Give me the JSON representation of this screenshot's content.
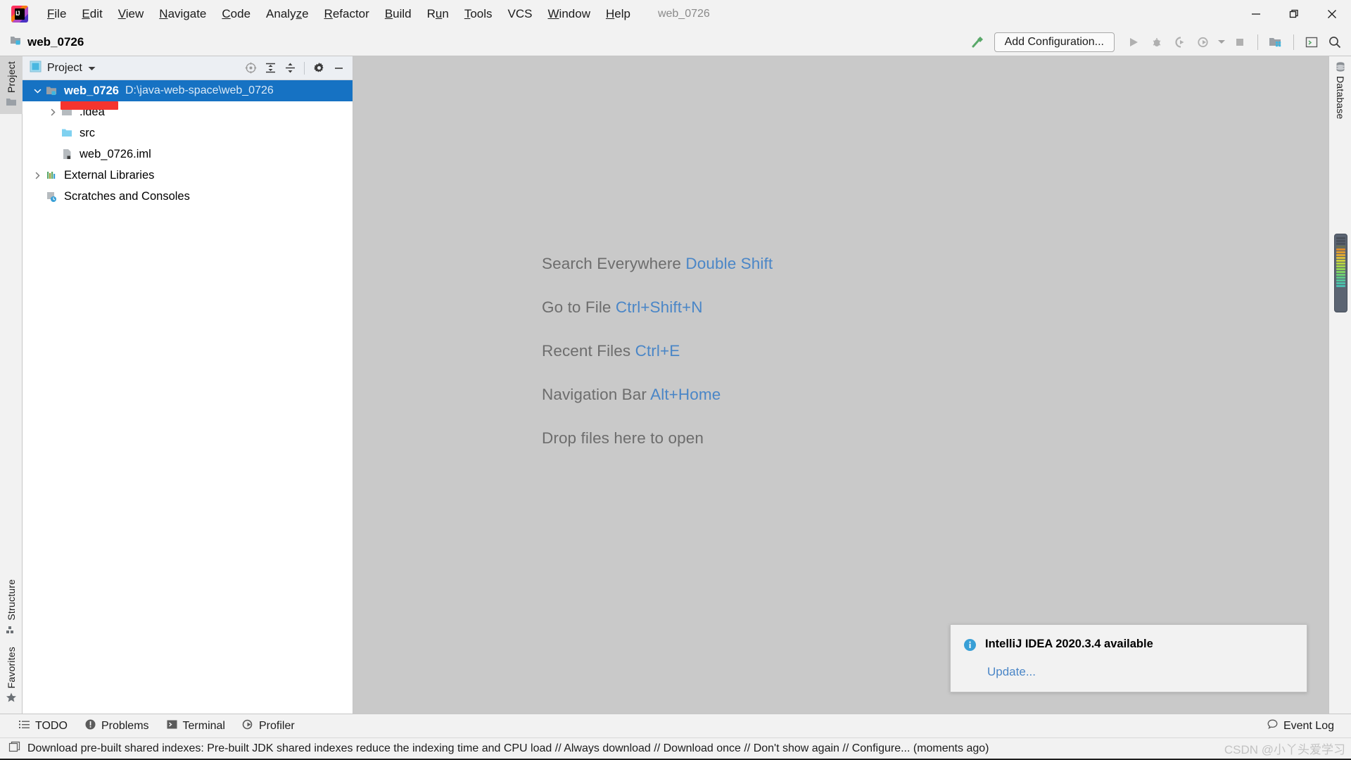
{
  "window": {
    "title": "web_0726",
    "controls": {
      "minimize": "minimize-icon",
      "maximize": "restore-icon",
      "close": "close-icon"
    }
  },
  "menubar": {
    "logo": "intellij-idea-logo",
    "items": [
      {
        "label": "File",
        "mnemonic": "F"
      },
      {
        "label": "Edit",
        "mnemonic": "E"
      },
      {
        "label": "View",
        "mnemonic": "V"
      },
      {
        "label": "Navigate",
        "mnemonic": "N"
      },
      {
        "label": "Code",
        "mnemonic": "C"
      },
      {
        "label": "Analyze",
        "mnemonic": "z"
      },
      {
        "label": "Refactor",
        "mnemonic": "R"
      },
      {
        "label": "Build",
        "mnemonic": "B"
      },
      {
        "label": "Run",
        "mnemonic": "u"
      },
      {
        "label": "Tools",
        "mnemonic": "T"
      },
      {
        "label": "VCS",
        "mnemonic": ""
      },
      {
        "label": "Window",
        "mnemonic": "W"
      },
      {
        "label": "Help",
        "mnemonic": "H"
      }
    ]
  },
  "toolbar": {
    "project_name": "web_0726",
    "project_icon": "module-folder-icon",
    "build_icon": "hammer-icon",
    "add_configuration_label": "Add Configuration...",
    "run_icon": "run-icon",
    "debug_icon": "debug-icon",
    "run_with_coverage_icon": "run-coverage-icon",
    "profile_icon": "profile-icon",
    "profile_dropdown_icon": "chevron-down-icon",
    "stop_icon": "stop-icon",
    "project_structure_icon": "project-structure-icon",
    "terminal_icon": "terminal-icon",
    "search_icon": "search-icon"
  },
  "left_rail": {
    "top": [
      {
        "label": "Project",
        "icon": "project-folder-icon",
        "active": true
      }
    ],
    "bottom": [
      {
        "label": "Structure",
        "icon": "structure-icon",
        "active": false
      },
      {
        "label": "Favorites",
        "icon": "star-icon",
        "active": false
      }
    ]
  },
  "right_rail": {
    "items": [
      {
        "label": "Database",
        "icon": "database-icon",
        "active": false
      }
    ]
  },
  "project_panel": {
    "header": {
      "view_icon": "project-view-icon",
      "title": "Project",
      "caret_icon": "chevron-down-icon",
      "actions": [
        {
          "name": "scroll-from-source-icon",
          "icon": "target-icon"
        },
        {
          "name": "expand-all-icon",
          "icon": "expand-all-icon"
        },
        {
          "name": "collapse-all-icon",
          "icon": "collapse-all-icon"
        },
        {
          "name": "settings-icon",
          "icon": "gear-icon"
        },
        {
          "name": "hide-icon",
          "icon": "minus-icon"
        }
      ]
    },
    "tree": [
      {
        "label": "web_0726",
        "path": "D:\\java-web-space\\web_0726",
        "icon": "module-folder-icon",
        "arrow": "expanded",
        "depth": 0,
        "selected": true,
        "redacted": false
      },
      {
        "label": ".idea",
        "path": "",
        "icon": "folder-icon",
        "arrow": "collapsed",
        "depth": 1,
        "selected": false,
        "redacted": true
      },
      {
        "label": "src",
        "path": "",
        "icon": "source-folder-icon",
        "arrow": "none",
        "depth": 1,
        "selected": false,
        "redacted": false
      },
      {
        "label": "web_0726.iml",
        "path": "",
        "icon": "iml-file-icon",
        "arrow": "none",
        "depth": 1,
        "selected": false,
        "redacted": false
      },
      {
        "label": "External Libraries",
        "path": "",
        "icon": "libraries-icon",
        "arrow": "collapsed",
        "depth": 0,
        "selected": false,
        "redacted": false
      },
      {
        "label": "Scratches and Consoles",
        "path": "",
        "icon": "scratches-icon",
        "arrow": "none",
        "depth": 0,
        "selected": false,
        "redacted": false
      }
    ]
  },
  "editor": {
    "tips": [
      {
        "action": "Search Everywhere",
        "shortcut": "Double Shift"
      },
      {
        "action": "Go to File",
        "shortcut": "Ctrl+Shift+N"
      },
      {
        "action": "Recent Files",
        "shortcut": "Ctrl+E"
      },
      {
        "action": "Navigation Bar",
        "shortcut": "Alt+Home"
      },
      {
        "action": "Drop files here to open",
        "shortcut": ""
      }
    ]
  },
  "notification": {
    "icon": "info-icon",
    "title": "IntelliJ IDEA 2020.3.4 available",
    "link": "Update..."
  },
  "statusbar": {
    "items": [
      {
        "label": "TODO",
        "icon": "todo-list-icon"
      },
      {
        "label": "Problems",
        "icon": "problems-icon"
      },
      {
        "label": "Terminal",
        "icon": "terminal-icon"
      },
      {
        "label": "Profiler",
        "icon": "profiler-icon"
      }
    ],
    "event_log": {
      "label": "Event Log",
      "icon": "event-log-icon"
    }
  },
  "message_bar": {
    "icon": "indexes-icon",
    "text": "Download pre-built shared indexes: Pre-built JDK shared indexes reduce the indexing time and CPU load // Always download // Download once // Don't show again // Configure... (moments ago)"
  },
  "watermark": {
    "text": "CSDN @小丫头爱学习"
  },
  "colors": {
    "accent": "#1672c3",
    "link": "#4a86c7",
    "editor_bg": "#c9c9c9",
    "chrome_bg": "#f2f2f2",
    "redaction": "#f5342e"
  }
}
